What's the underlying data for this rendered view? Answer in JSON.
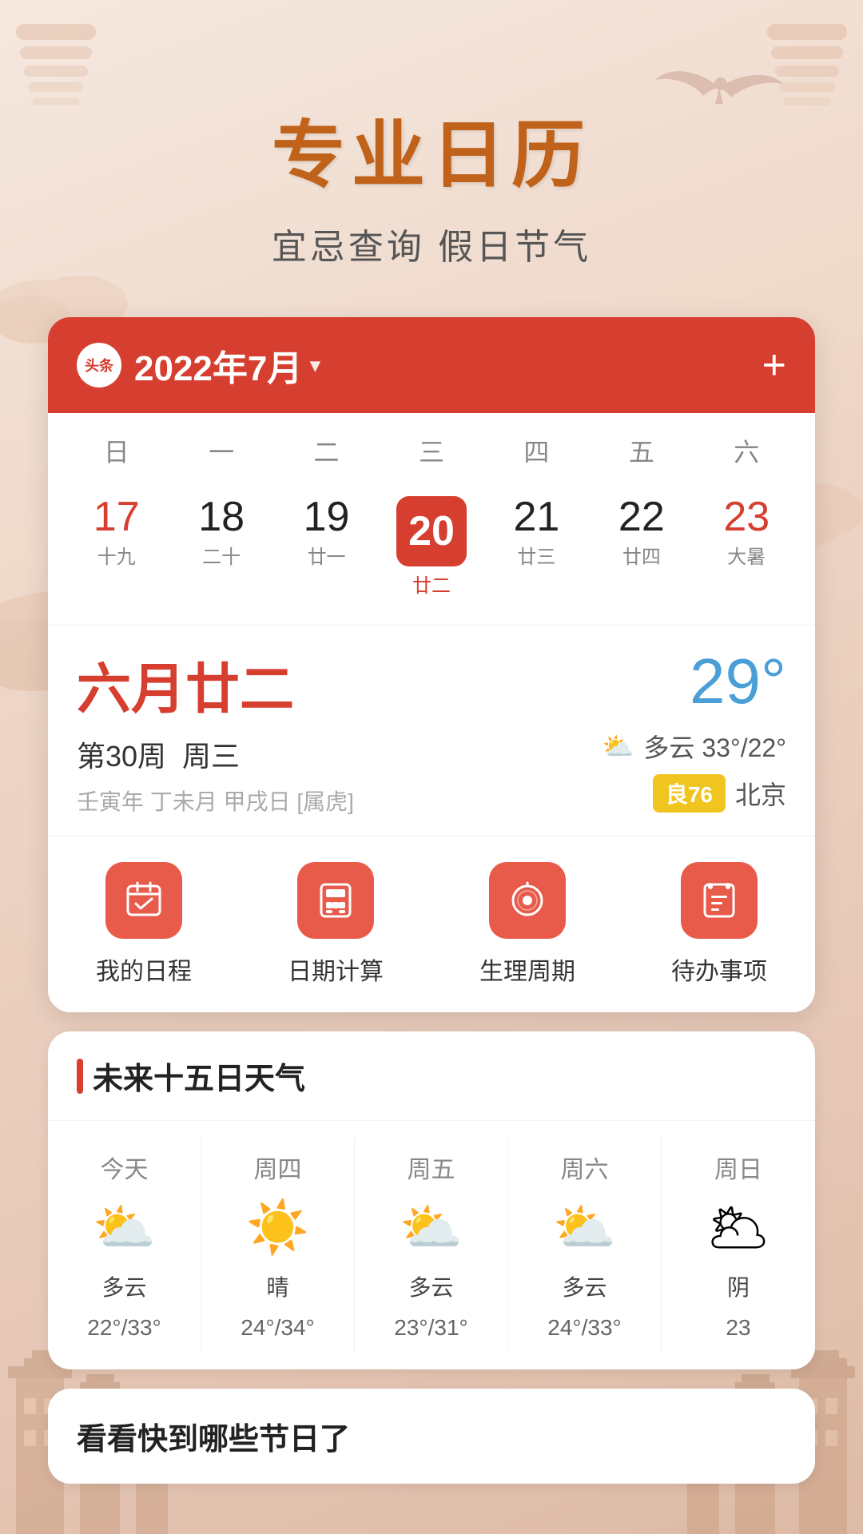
{
  "header": {
    "main_title": "专业日历",
    "subtitle": "宜忌查询 假日节气"
  },
  "calendar": {
    "month_label": "2022年7月",
    "add_button": "+",
    "logo_text": "头条",
    "dow": [
      "日",
      "一",
      "二",
      "三",
      "四",
      "五",
      "六"
    ],
    "dates": [
      {
        "num": "17",
        "lunar": "十九",
        "red": true,
        "today": false
      },
      {
        "num": "18",
        "lunar": "二十",
        "red": false,
        "today": false
      },
      {
        "num": "19",
        "lunar": "廿一",
        "red": false,
        "today": false
      },
      {
        "num": "20",
        "lunar": "廿二",
        "red": false,
        "today": true
      },
      {
        "num": "21",
        "lunar": "廿三",
        "red": false,
        "today": false
      },
      {
        "num": "22",
        "lunar": "廿四",
        "red": false,
        "today": false
      },
      {
        "num": "23",
        "lunar": "大暑",
        "red": true,
        "today": false
      }
    ],
    "lunar_date_big": "六月廿二",
    "week_label": "第30周",
    "weekday": "周三",
    "ganzhi": "壬寅年 丁未月 甲戌日 [属虎]",
    "temperature": "29°",
    "weather_desc": "多云 33°/22°",
    "aqi": "良76",
    "location": "北京"
  },
  "quick_actions": [
    {
      "label": "我的日程",
      "icon": "calendar-check"
    },
    {
      "label": "日期计算",
      "icon": "calculator"
    },
    {
      "label": "生理周期",
      "icon": "cycle"
    },
    {
      "label": "待办事项",
      "icon": "todo"
    }
  ],
  "weather": {
    "section_title": "未来十五日天气",
    "days": [
      {
        "label": "今天",
        "icon": "⛅",
        "desc": "多云",
        "temp": "22°/33°"
      },
      {
        "label": "周四",
        "icon": "☀️",
        "desc": "晴",
        "temp": "24°/34°"
      },
      {
        "label": "周五",
        "icon": "⛅",
        "desc": "多云",
        "temp": "23°/31°"
      },
      {
        "label": "周六",
        "icon": "⛅",
        "desc": "多云",
        "temp": "24°/33°"
      },
      {
        "label": "周日",
        "icon": "🌥",
        "desc": "阴",
        "temp": "23°"
      }
    ]
  },
  "holidays": {
    "title": "看看快到哪些节日了"
  }
}
